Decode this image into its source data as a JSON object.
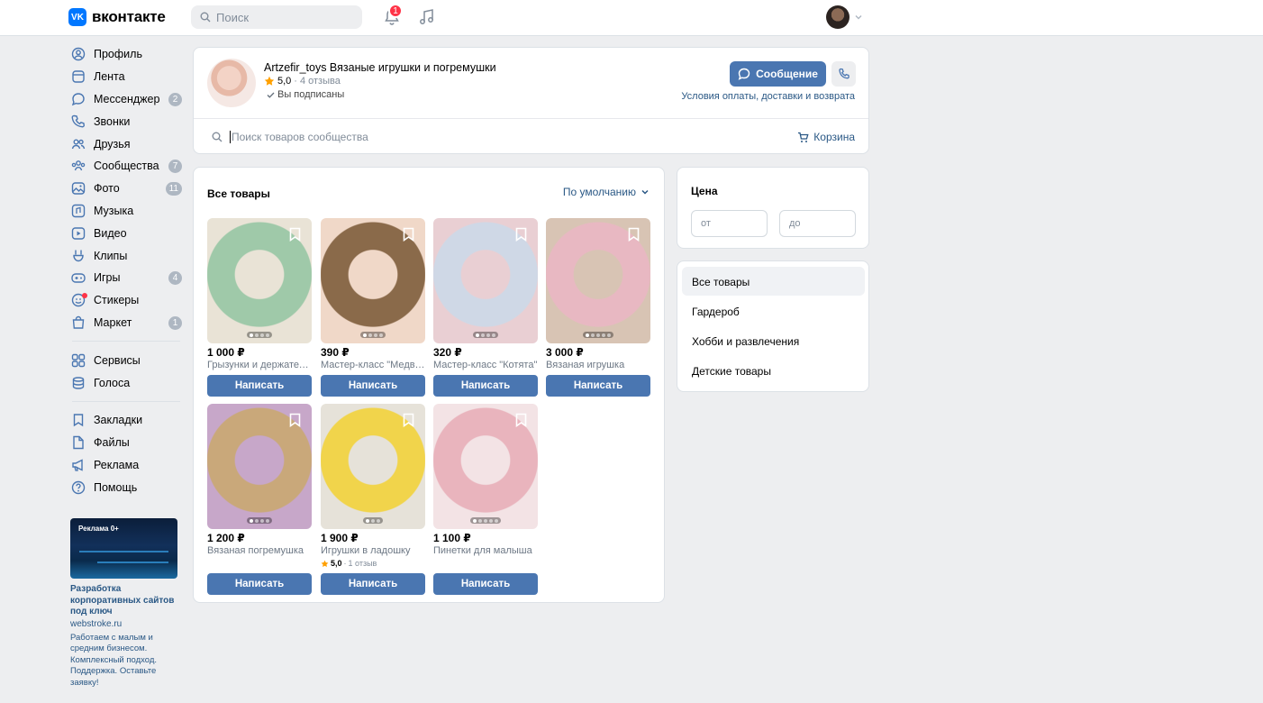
{
  "header": {
    "logo_mark": "VK",
    "logo_text": "вконтакте",
    "search_placeholder": "Поиск",
    "notifications_count": "1"
  },
  "nav": {
    "items": [
      {
        "label": "Профиль",
        "icon": "user-circle-icon"
      },
      {
        "label": "Лента",
        "icon": "feed-icon"
      },
      {
        "label": "Мессенджер",
        "icon": "message-icon",
        "count": "2"
      },
      {
        "label": "Звонки",
        "icon": "phone-icon"
      },
      {
        "label": "Друзья",
        "icon": "friends-icon"
      },
      {
        "label": "Сообщества",
        "icon": "communities-icon",
        "count": "7"
      },
      {
        "label": "Фото",
        "icon": "photo-icon",
        "count": "11"
      },
      {
        "label": "Музыка",
        "icon": "music-icon"
      },
      {
        "label": "Видео",
        "icon": "video-icon"
      },
      {
        "label": "Клипы",
        "icon": "clips-icon"
      },
      {
        "label": "Игры",
        "icon": "games-icon",
        "count": "4"
      },
      {
        "label": "Стикеры",
        "icon": "stickers-icon"
      },
      {
        "label": "Маркет",
        "icon": "market-icon",
        "count": "1"
      }
    ],
    "services": [
      {
        "label": "Сервисы",
        "icon": "services-icon"
      },
      {
        "label": "Голоса",
        "icon": "votes-icon"
      }
    ],
    "extra": [
      {
        "label": "Закладки",
        "icon": "bookmark-icon"
      },
      {
        "label": "Файлы",
        "icon": "file-icon"
      },
      {
        "label": "Реклама",
        "icon": "megaphone-icon"
      },
      {
        "label": "Помощь",
        "icon": "help-icon"
      }
    ]
  },
  "ad": {
    "badge": "Реклама 0+",
    "title": "Разработка корпоративных сайтов под ключ",
    "domain": "webstroke.ru",
    "text": "Работаем с малым и средним бизнесом. Комплексный подход. Поддержка. Оставьте заявку!"
  },
  "shop": {
    "name": "Artzefir_toys Вязаные игрушки и погремушки",
    "rating": "5,0",
    "reviews": "4 отзыва",
    "subscribed": "Вы подписаны",
    "message_button": "Сообщение",
    "terms_link": "Условия оплаты, доставки и возврата",
    "goods_search_placeholder": "Поиск товаров сообщества",
    "cart": "Корзина"
  },
  "goods": {
    "title": "Все товары",
    "sort": "По умолчанию",
    "write_label": "Написать",
    "items": [
      {
        "price": "1 000 ₽",
        "name": "Грызунки и держатели для пустышек",
        "colors": [
          "#9fc9a9",
          "#e9e3d6"
        ],
        "dots": 4,
        "active": 0
      },
      {
        "price": "390 ₽",
        "name": "Мастер-класс \"Медвежата\"",
        "colors": [
          "#8a6a4a",
          "#f0d8c8"
        ],
        "dots": 4,
        "active": 0
      },
      {
        "price": "320 ₽",
        "name": "Мастер-класс \"Котята\"",
        "colors": [
          "#cfd8e6",
          "#e9cfd3"
        ],
        "dots": 4,
        "active": 0
      },
      {
        "price": "3 000 ₽",
        "name": "Вязаная игрушка",
        "colors": [
          "#e8b8c2",
          "#d8c4b4"
        ],
        "dots": 5,
        "active": 0
      },
      {
        "price": "1 200 ₽",
        "name": "Вязаная погремушка",
        "colors": [
          "#c9a87a",
          "#c7a7c9"
        ],
        "dots": 4,
        "active": 0
      },
      {
        "price": "1 900 ₽",
        "name": "Игрушки в ладошку",
        "colors": [
          "#f1d44b",
          "#e6e2d9"
        ],
        "dots": 3,
        "active": 0,
        "rating": "5,0",
        "reviews": "1 отзыв"
      },
      {
        "price": "1 100 ₽",
        "name": "Пинетки для малыша",
        "colors": [
          "#e9b4bd",
          "#f3e3e5"
        ],
        "dots": 5,
        "active": 0
      }
    ]
  },
  "price_filter": {
    "title": "Цена",
    "from_placeholder": "от",
    "to_placeholder": "до"
  },
  "categories": {
    "items": [
      "Все товары",
      "Гардероб",
      "Хобби и развлечения",
      "Детские товары"
    ],
    "selected": 0
  },
  "colors": {
    "accent": "#4a76b1",
    "link": "#2a5885",
    "badge_red": "#ff3347",
    "star": "#ffa000"
  }
}
